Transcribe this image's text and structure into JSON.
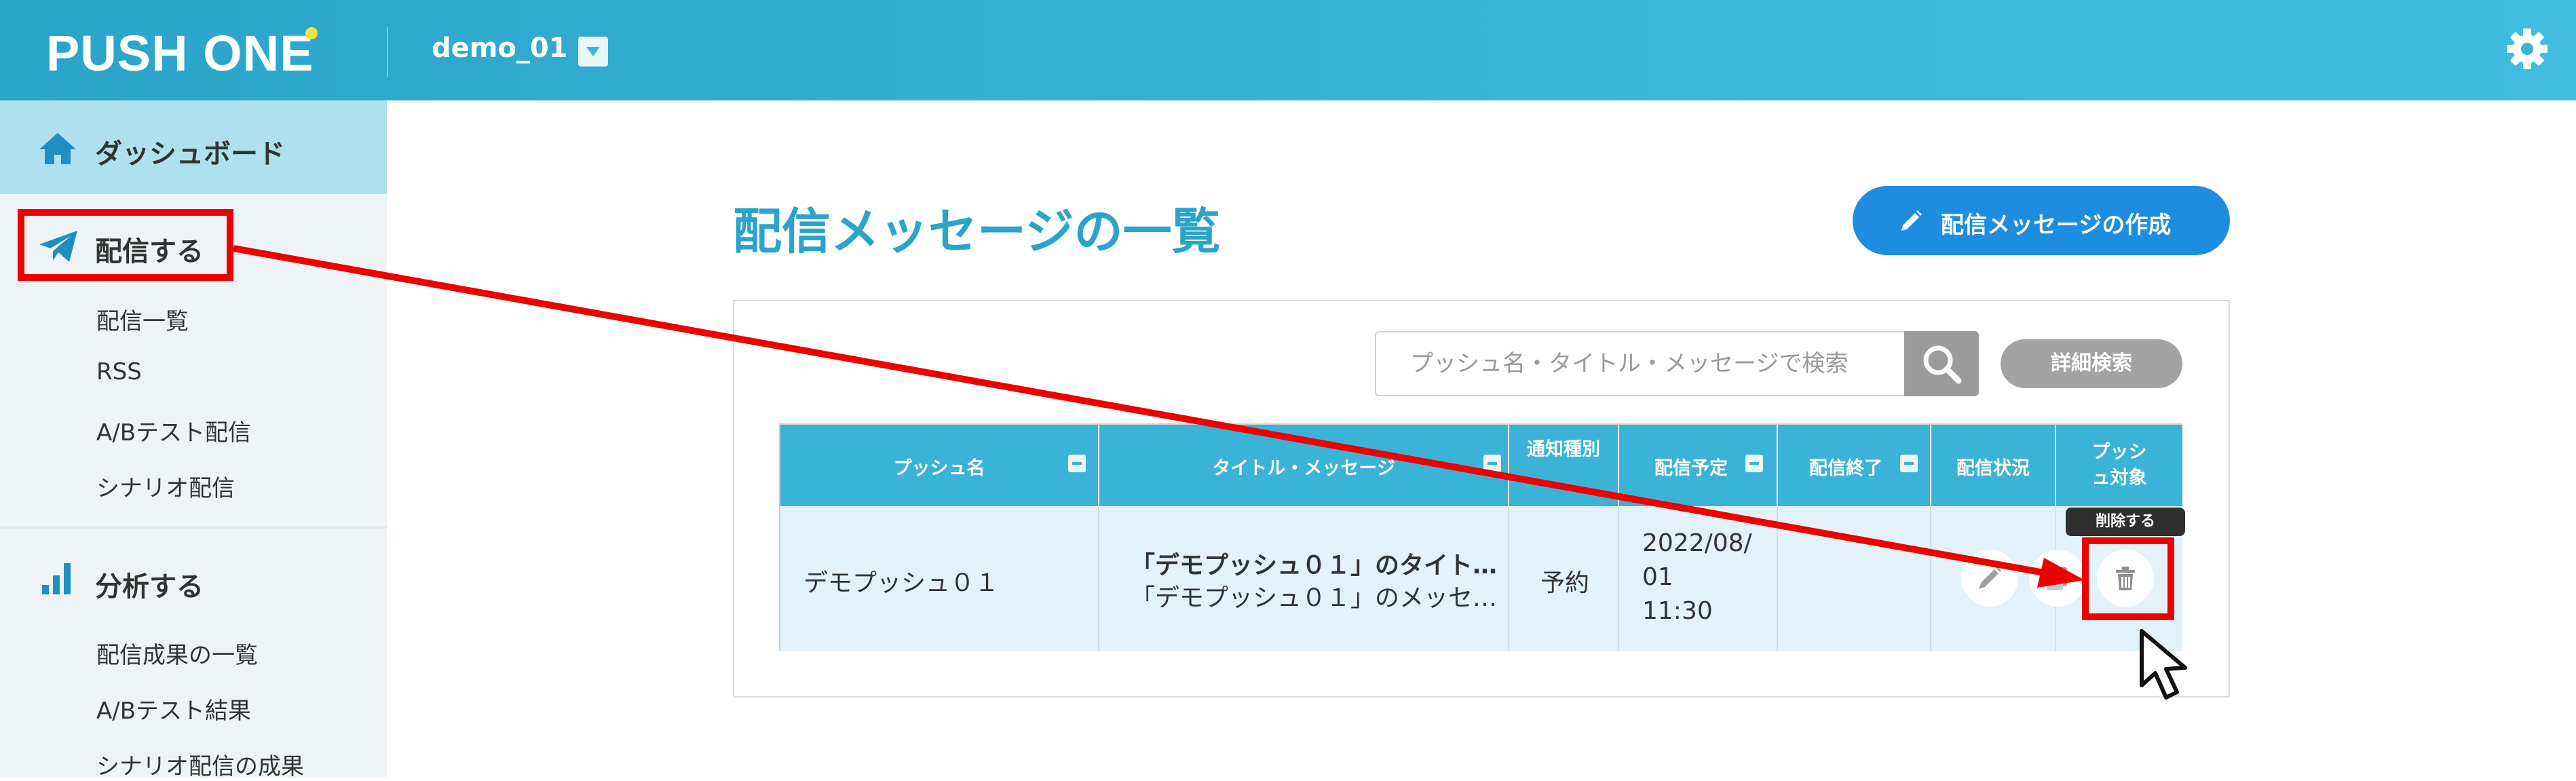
{
  "header": {
    "logo_text": "PUSH ONE",
    "project": "demo_01",
    "colors": {
      "header_gradient_start": "#2aa4c9",
      "header_gradient_end": "#42bddf"
    }
  },
  "sidebar": {
    "dashboard": "ダッシュボード",
    "sections": [
      {
        "label": "配信する",
        "icon": "paper-plane-icon",
        "items": [
          "配信一覧",
          "RSS",
          "A/Bテスト配信",
          "シナリオ配信"
        ]
      },
      {
        "label": "分析する",
        "icon": "bar-chart-icon",
        "items": [
          "配信成果の一覧",
          "A/Bテスト結果",
          "シナリオ配信の成果"
        ]
      }
    ]
  },
  "main": {
    "title": "配信メッセージの一覧",
    "create_button": "配信メッセージの作成",
    "search": {
      "placeholder": "プッシュ名・タイトル・メッセージで検索",
      "value": ""
    },
    "advanced_search": "詳細検索",
    "table": {
      "columns": {
        "push_name": "プッシュ名",
        "title_message": "タイトル・メッセージ",
        "notification_type": "通知種別",
        "scheduled": "配信予定",
        "ended": "配信終了",
        "status": "配信状況",
        "target": "プッシュ対象"
      },
      "rows": [
        {
          "push_name": "デモプッシュ０１",
          "title": "「デモプッシュ０１」のタイト…",
          "message": "「デモプッシュ０１」のメッセ…",
          "notification_type": "予約",
          "scheduled_date": "2022/08/",
          "scheduled_day": "01",
          "scheduled_time": "11:30",
          "ended": ""
        }
      ]
    },
    "delete_tooltip": "削除する"
  },
  "annotation": {
    "color": "#ee0000"
  }
}
